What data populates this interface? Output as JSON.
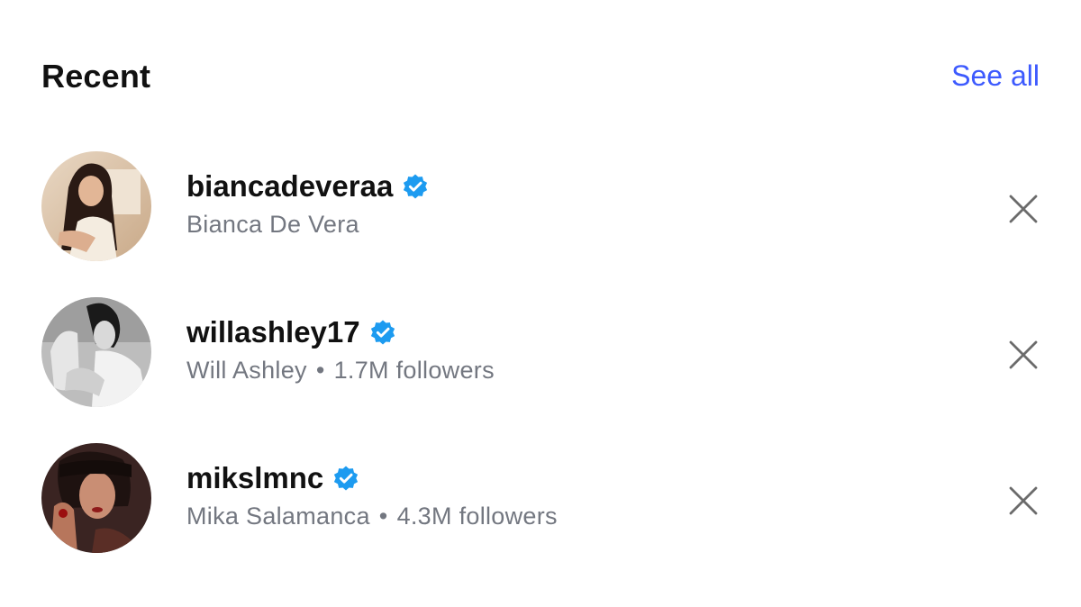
{
  "header": {
    "title": "Recent",
    "see_all_label": "See all"
  },
  "colors": {
    "accent": "#3d5afe",
    "verified": "#1d9bf0",
    "secondary_text": "#737780",
    "close_icon": "#6b6b6b"
  },
  "recent": [
    {
      "username": "biancadeveraa",
      "verified": true,
      "subtitle": "Bianca De Vera",
      "followers": "",
      "avatar_icon": "avatar-photo"
    },
    {
      "username": "willashley17",
      "verified": true,
      "subtitle": "Will Ashley",
      "separator": "•",
      "followers": "1.7M followers",
      "avatar_icon": "avatar-photo"
    },
    {
      "username": "mikslmnc",
      "verified": true,
      "subtitle": "Mika Salamanca",
      "separator": "•",
      "followers": "4.3M followers",
      "avatar_icon": "avatar-photo"
    }
  ]
}
